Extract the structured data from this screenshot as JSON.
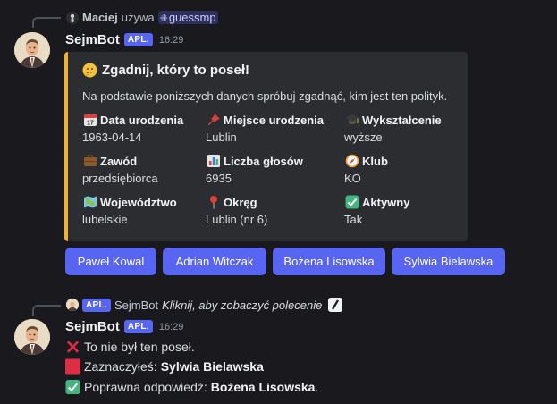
{
  "colors": {
    "background": "#1a1a1e",
    "embed_bg": "#2b2d31",
    "embed_accent": "#f0b232",
    "button_bg": "#5865f2",
    "app_badge_bg": "#5865f2"
  },
  "reply1": {
    "user": "Maciej",
    "action": "używa",
    "command": "guessmp"
  },
  "msg1": {
    "username": "SejmBot",
    "badge": "APL.",
    "time": "16:29",
    "embed": {
      "title": "Zgadnij, który to poseł!",
      "title_icon": "thinking-face-icon",
      "description": "Na podstawie poniższych danych spróbuj zgadnąć, kim jest ten polityk.",
      "fields": [
        {
          "icon": "calendar-icon",
          "name": "Data urodzenia",
          "value": "1963-04-14"
        },
        {
          "icon": "pushpin-icon",
          "name": "Miejsce urodzenia",
          "value": "Lublin"
        },
        {
          "icon": "graduation-cap-icon",
          "name": "Wykształcenie",
          "value": "wyższe"
        },
        {
          "icon": "briefcase-icon",
          "name": "Zawód",
          "value": "przedsiębiorca"
        },
        {
          "icon": "bar-chart-icon",
          "name": "Liczba głosów",
          "value": "6935"
        },
        {
          "icon": "compass-icon",
          "name": "Klub",
          "value": "KO"
        },
        {
          "icon": "map-icon",
          "name": "Województwo",
          "value": "lubelskie"
        },
        {
          "icon": "round-pushpin-icon",
          "name": "Okręg",
          "value": "Lublin (nr 6)"
        },
        {
          "icon": "check-mark-icon",
          "name": "Aktywny",
          "value": "Tak"
        }
      ]
    },
    "buttons": [
      "Paweł Kowal",
      "Adrian Witczak",
      "Bożena Lisowska",
      "Sylwia Bielawska"
    ]
  },
  "reply2": {
    "badge": "APL.",
    "user": "SejmBot",
    "text": "Kliknij, aby zobaczyć polecenie"
  },
  "msg2": {
    "username": "SejmBot",
    "badge": "APL.",
    "time": "16:29",
    "line1": "To nie był ten poseł.",
    "line2_label": "Zaznaczyłeś:",
    "line2_value": "Sylwia Bielawska",
    "line3_label": "Poprawna odpowiedź:",
    "line3_value": "Bożena Lisowska",
    "line3_end": "."
  }
}
